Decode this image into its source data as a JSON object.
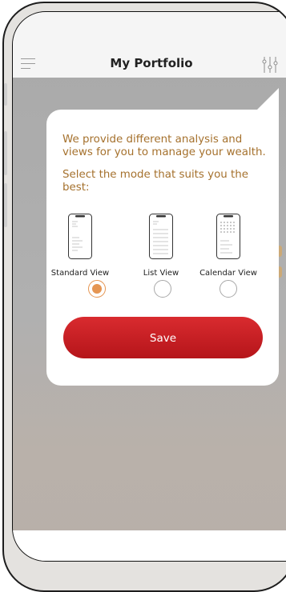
{
  "header": {
    "title": "My Portfolio"
  },
  "popup": {
    "message_line1": "We provide different analysis and views for you to manage your wealth.",
    "message_line2": "Select the mode that suits you the best:",
    "modes": [
      {
        "label": "Standard View",
        "selected": true
      },
      {
        "label": "List View",
        "selected": false
      },
      {
        "label": "Calendar View",
        "selected": false
      }
    ],
    "save_label": "Save"
  },
  "colors": {
    "accent": "#e59552",
    "save_button": "#c81f24",
    "message_text": "#a5712d",
    "overlay": "#aaaaaa"
  },
  "icons": {
    "menu": "hamburger-icon",
    "filter": "filter-sliders-icon"
  }
}
